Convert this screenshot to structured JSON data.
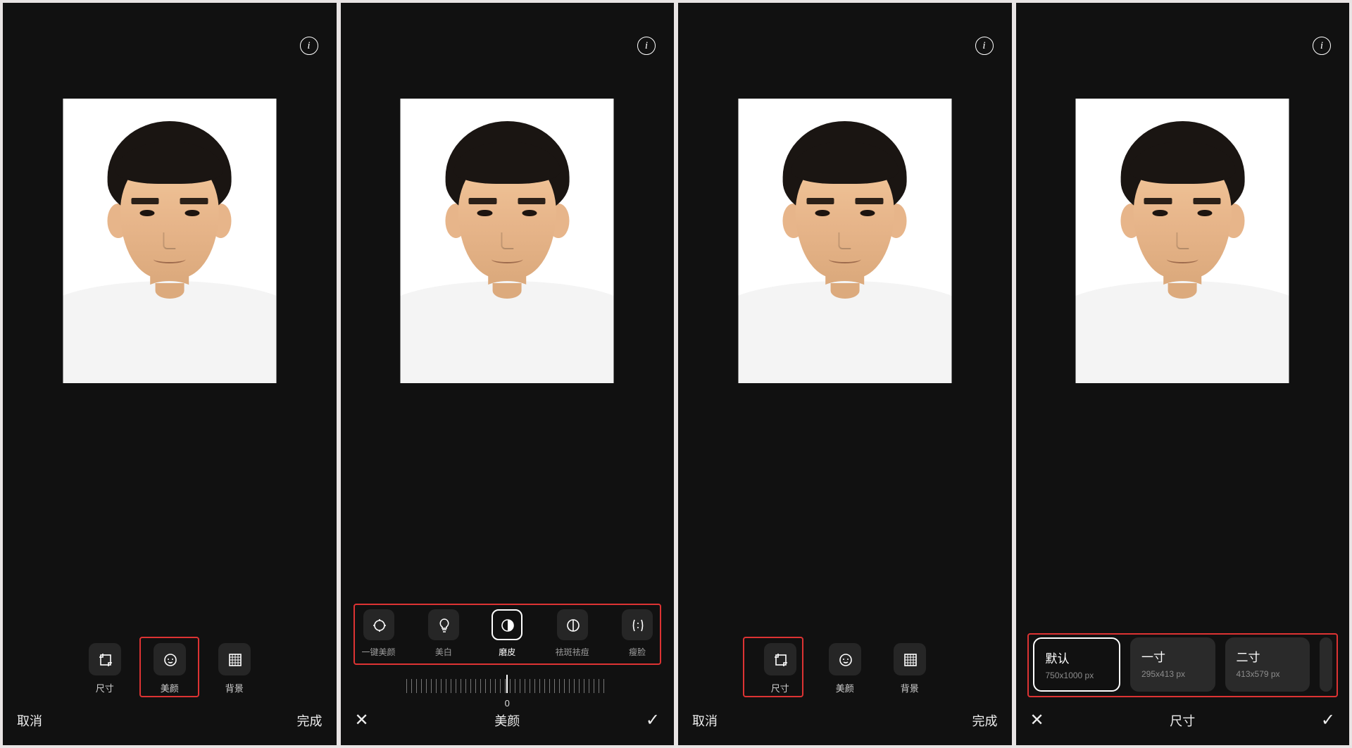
{
  "common": {
    "cancel": "取消",
    "done": "完成",
    "info_alt": "info"
  },
  "tools": {
    "size": "尺寸",
    "beauty": "美颜",
    "background": "背景"
  },
  "beauty": {
    "title": "美颜",
    "options": {
      "one_key": "一键美颜",
      "whiten": "美白",
      "smooth": "磨皮",
      "spot": "祛斑祛痘",
      "slim": "瘦脸"
    },
    "slider_value": "0"
  },
  "size": {
    "title": "尺寸",
    "presets": [
      {
        "name": "默认",
        "dim": "750x1000 px"
      },
      {
        "name": "一寸",
        "dim": "295x413 px"
      },
      {
        "name": "二寸",
        "dim": "413x579 px"
      }
    ]
  }
}
